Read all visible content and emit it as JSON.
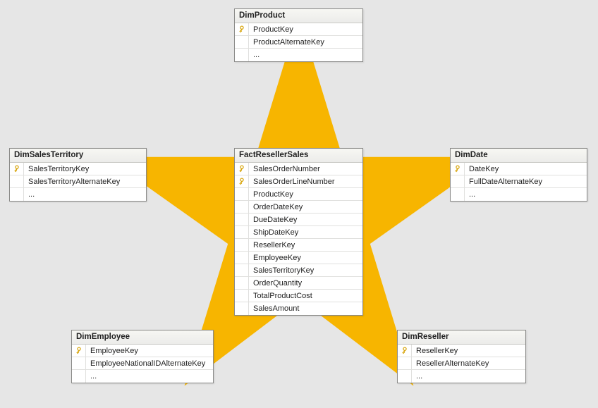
{
  "star_color": "#f4b400",
  "tables": {
    "dimProduct": {
      "title": "DimProduct",
      "rows": [
        {
          "key": true,
          "name": "ProductKey"
        },
        {
          "key": false,
          "name": "ProductAlternateKey"
        },
        {
          "key": false,
          "name": "..."
        }
      ]
    },
    "dimSalesTerritory": {
      "title": "DimSalesTerritory",
      "rows": [
        {
          "key": true,
          "name": "SalesTerritoryKey"
        },
        {
          "key": false,
          "name": "SalesTerritoryAlternateKey"
        },
        {
          "key": false,
          "name": "..."
        }
      ]
    },
    "factResellerSales": {
      "title": "FactResellerSales",
      "rows": [
        {
          "key": true,
          "name": "SalesOrderNumber"
        },
        {
          "key": true,
          "name": "SalesOrderLineNumber"
        },
        {
          "key": false,
          "name": "ProductKey"
        },
        {
          "key": false,
          "name": "OrderDateKey"
        },
        {
          "key": false,
          "name": "DueDateKey"
        },
        {
          "key": false,
          "name": "ShipDateKey"
        },
        {
          "key": false,
          "name": "ResellerKey"
        },
        {
          "key": false,
          "name": "EmployeeKey"
        },
        {
          "key": false,
          "name": "SalesTerritoryKey"
        },
        {
          "key": false,
          "name": "OrderQuantity"
        },
        {
          "key": false,
          "name": "TotalProductCost"
        },
        {
          "key": false,
          "name": "SalesAmount"
        }
      ]
    },
    "dimDate": {
      "title": "DimDate",
      "rows": [
        {
          "key": true,
          "name": "DateKey"
        },
        {
          "key": false,
          "name": "FullDateAlternateKey"
        },
        {
          "key": false,
          "name": "..."
        }
      ]
    },
    "dimEmployee": {
      "title": "DimEmployee",
      "rows": [
        {
          "key": true,
          "name": "EmployeeKey"
        },
        {
          "key": false,
          "name": "EmployeeNationalIDAlternateKey"
        },
        {
          "key": false,
          "name": "..."
        }
      ]
    },
    "dimReseller": {
      "title": "DimReseller",
      "rows": [
        {
          "key": true,
          "name": "ResellerKey"
        },
        {
          "key": false,
          "name": "ResellerAlternateKey"
        },
        {
          "key": false,
          "name": "..."
        }
      ]
    }
  }
}
